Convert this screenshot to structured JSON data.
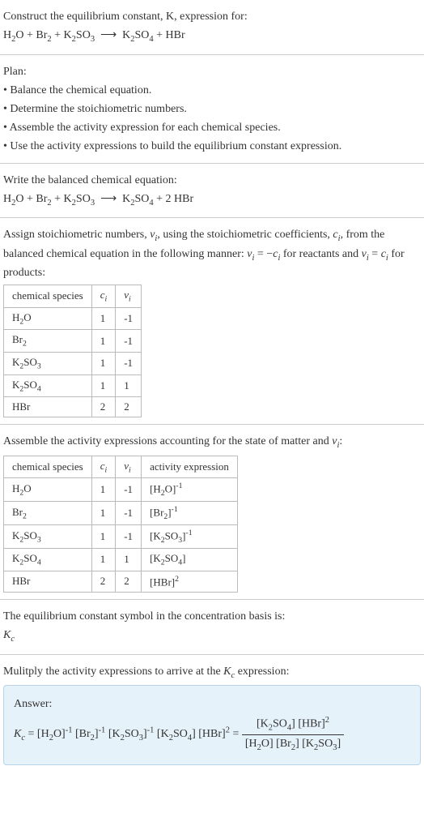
{
  "header": {
    "prompt": "Construct the equilibrium constant, K, expression for:",
    "equation": "H₂O + Br₂ + K₂SO₃ ⟶ K₂SO₄ + HBr"
  },
  "plan": {
    "title": "Plan:",
    "steps": [
      "• Balance the chemical equation.",
      "• Determine the stoichiometric numbers.",
      "• Assemble the activity expression for each chemical species.",
      "• Use the activity expressions to build the equilibrium constant expression."
    ]
  },
  "balanced": {
    "title": "Write the balanced chemical equation:",
    "equation": "H₂O + Br₂ + K₂SO₃ ⟶ K₂SO₄ + 2 HBr"
  },
  "stoich": {
    "intro_a": "Assign stoichiometric numbers, νᵢ, using the stoichiometric coefficients, cᵢ, from the balanced chemical equation in the following manner: νᵢ = −cᵢ for reactants and νᵢ = cᵢ for products:",
    "table": {
      "headers": [
        "chemical species",
        "cᵢ",
        "νᵢ"
      ],
      "rows": [
        [
          "H₂O",
          "1",
          "-1"
        ],
        [
          "Br₂",
          "1",
          "-1"
        ],
        [
          "K₂SO₃",
          "1",
          "-1"
        ],
        [
          "K₂SO₄",
          "1",
          "1"
        ],
        [
          "HBr",
          "2",
          "2"
        ]
      ]
    }
  },
  "activity": {
    "intro": "Assemble the activity expressions accounting for the state of matter and νᵢ:",
    "table": {
      "headers": [
        "chemical species",
        "cᵢ",
        "νᵢ",
        "activity expression"
      ],
      "rows": [
        [
          "H₂O",
          "1",
          "-1",
          "[H₂O]⁻¹"
        ],
        [
          "Br₂",
          "1",
          "-1",
          "[Br₂]⁻¹"
        ],
        [
          "K₂SO₃",
          "1",
          "-1",
          "[K₂SO₃]⁻¹"
        ],
        [
          "K₂SO₄",
          "1",
          "1",
          "[K₂SO₄]"
        ],
        [
          "HBr",
          "2",
          "2",
          "[HBr]²"
        ]
      ]
    }
  },
  "symbol": {
    "line1": "The equilibrium constant symbol in the concentration basis is:",
    "line2": "K_c"
  },
  "final": {
    "intro": "Mulitply the activity expressions to arrive at the K_c expression:",
    "answer_label": "Answer:",
    "expr_left": "K_c = [H₂O]⁻¹ [Br₂]⁻¹ [K₂SO₃]⁻¹ [K₂SO₄] [HBr]² =",
    "frac_num": "[K₂SO₄] [HBr]²",
    "frac_den": "[H₂O] [Br₂] [K₂SO₃]"
  }
}
